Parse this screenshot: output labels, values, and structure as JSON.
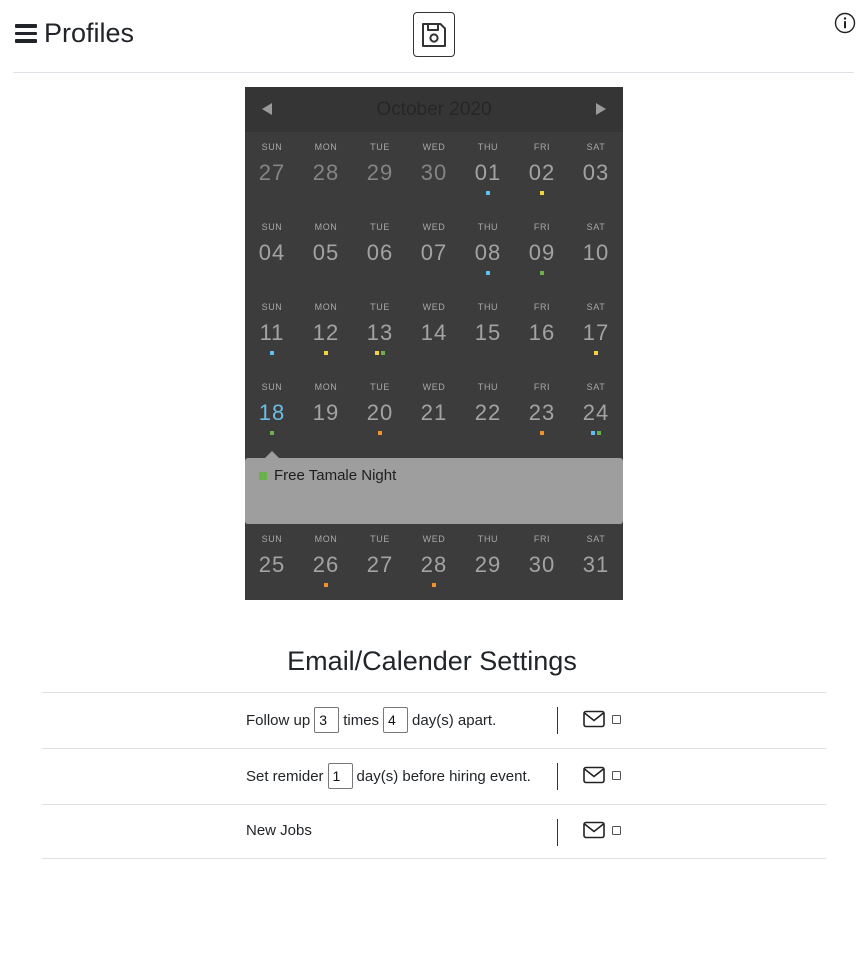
{
  "header": {
    "title": "Profiles",
    "menu_icon": "hamburger-menu-icon",
    "save_icon": "floppy-disk-icon",
    "info_icon": "info-circle-icon"
  },
  "calendar": {
    "month_label": "October 2020",
    "weeks": [
      {
        "days": [
          {
            "dow": "SUN",
            "num": "27",
            "other": true,
            "dots": []
          },
          {
            "dow": "MON",
            "num": "28",
            "other": true,
            "dots": []
          },
          {
            "dow": "TUE",
            "num": "29",
            "other": true,
            "dots": []
          },
          {
            "dow": "WED",
            "num": "30",
            "other": true,
            "dots": []
          },
          {
            "dow": "THU",
            "num": "01",
            "dots": [
              "blue"
            ]
          },
          {
            "dow": "FRI",
            "num": "02",
            "dots": [
              "yellow"
            ]
          },
          {
            "dow": "SAT",
            "num": "03",
            "dots": []
          }
        ]
      },
      {
        "days": [
          {
            "dow": "SUN",
            "num": "04",
            "dots": []
          },
          {
            "dow": "MON",
            "num": "05",
            "dots": []
          },
          {
            "dow": "TUE",
            "num": "06",
            "dots": []
          },
          {
            "dow": "WED",
            "num": "07",
            "dots": []
          },
          {
            "dow": "THU",
            "num": "08",
            "dots": [
              "blue"
            ]
          },
          {
            "dow": "FRI",
            "num": "09",
            "dots": [
              "green"
            ]
          },
          {
            "dow": "SAT",
            "num": "10",
            "dots": []
          }
        ]
      },
      {
        "days": [
          {
            "dow": "SUN",
            "num": "11",
            "dots": [
              "blue"
            ]
          },
          {
            "dow": "MON",
            "num": "12",
            "dots": [
              "yellow"
            ]
          },
          {
            "dow": "TUE",
            "num": "13",
            "dots": [
              "yellow",
              "green"
            ]
          },
          {
            "dow": "WED",
            "num": "14",
            "dots": []
          },
          {
            "dow": "THU",
            "num": "15",
            "dots": []
          },
          {
            "dow": "FRI",
            "num": "16",
            "dots": []
          },
          {
            "dow": "SAT",
            "num": "17",
            "dots": [
              "yellow"
            ]
          }
        ]
      },
      {
        "days": [
          {
            "dow": "SUN",
            "num": "18",
            "today": true,
            "dots": [
              "green"
            ]
          },
          {
            "dow": "MON",
            "num": "19",
            "dots": []
          },
          {
            "dow": "TUE",
            "num": "20",
            "dots": [
              "orange"
            ]
          },
          {
            "dow": "WED",
            "num": "21",
            "dots": []
          },
          {
            "dow": "THU",
            "num": "22",
            "dots": []
          },
          {
            "dow": "FRI",
            "num": "23",
            "dots": [
              "orange"
            ]
          },
          {
            "dow": "SAT",
            "num": "24",
            "dots": [
              "blue",
              "green"
            ]
          }
        ]
      },
      {
        "days": [
          {
            "dow": "SUN",
            "num": "25",
            "dots": []
          },
          {
            "dow": "MON",
            "num": "26",
            "dots": [
              "orange"
            ]
          },
          {
            "dow": "TUE",
            "num": "27",
            "dots": []
          },
          {
            "dow": "WED",
            "num": "28",
            "dots": [
              "orange"
            ]
          },
          {
            "dow": "THU",
            "num": "29",
            "dots": []
          },
          {
            "dow": "FRI",
            "num": "30",
            "dots": []
          },
          {
            "dow": "SAT",
            "num": "31",
            "dots": []
          }
        ]
      }
    ],
    "selected_event": {
      "title": "Free Tamale Night",
      "color": "#6ab04c"
    },
    "colors": {
      "blue": "#5bc0eb",
      "yellow": "#f5d33f",
      "green": "#6ab04c",
      "orange": "#f0932b",
      "today": "#6cbce6"
    }
  },
  "settings": {
    "title": "Email/Calender Settings",
    "follow_up": {
      "prefix": "Follow up",
      "times_value": "3",
      "times_label": "times",
      "days_value": "4",
      "suffix": "day(s) apart."
    },
    "reminder": {
      "prefix": "Set remider",
      "days_value": "1",
      "suffix": "day(s) before hiring event."
    },
    "new_jobs": {
      "label": "New Jobs"
    },
    "mail_icon": "envelope-icon"
  }
}
